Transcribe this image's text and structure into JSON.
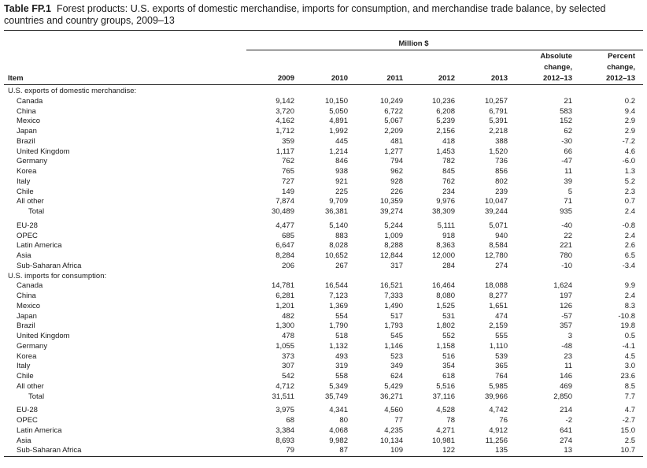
{
  "title": {
    "label": "Table FP.1",
    "text": "Forest products: U.S. exports of domestic merchandise, imports for consumption, and merchandise trade balance, by selected countries and country groups, 2009–13"
  },
  "header": {
    "unit": "Million $",
    "item": "Item",
    "years": [
      "2009",
      "2010",
      "2011",
      "2012",
      "2013"
    ],
    "abs_change": [
      "Absolute",
      "change,",
      "2012–13"
    ],
    "pct_change": [
      "Percent",
      "change,",
      "2012–13"
    ]
  },
  "rows": [
    {
      "type": "section",
      "label": "U.S. exports of domestic merchandise:"
    },
    {
      "label": "Canada",
      "values": [
        "9,142",
        "10,150",
        "10,249",
        "10,236",
        "10,257",
        "21",
        "0.2"
      ]
    },
    {
      "label": "China",
      "values": [
        "3,720",
        "5,050",
        "6,722",
        "6,208",
        "6,791",
        "583",
        "9.4"
      ]
    },
    {
      "label": "Mexico",
      "values": [
        "4,162",
        "4,891",
        "5,067",
        "5,239",
        "5,391",
        "152",
        "2.9"
      ]
    },
    {
      "label": "Japan",
      "values": [
        "1,712",
        "1,992",
        "2,209",
        "2,156",
        "2,218",
        "62",
        "2.9"
      ]
    },
    {
      "label": "Brazil",
      "values": [
        "359",
        "445",
        "481",
        "418",
        "388",
        "-30",
        "-7.2"
      ]
    },
    {
      "label": "United Kingdom",
      "values": [
        "1,117",
        "1,214",
        "1,277",
        "1,453",
        "1,520",
        "66",
        "4.6"
      ]
    },
    {
      "label": "Germany",
      "values": [
        "762",
        "846",
        "794",
        "782",
        "736",
        "-47",
        "-6.0"
      ]
    },
    {
      "label": "Korea",
      "values": [
        "765",
        "938",
        "962",
        "845",
        "856",
        "11",
        "1.3"
      ]
    },
    {
      "label": "Italy",
      "values": [
        "727",
        "921",
        "928",
        "762",
        "802",
        "39",
        "5.2"
      ]
    },
    {
      "label": "Chile",
      "values": [
        "149",
        "225",
        "226",
        "234",
        "239",
        "5",
        "2.3"
      ]
    },
    {
      "label": "All other",
      "values": [
        "7,874",
        "9,709",
        "10,359",
        "9,976",
        "10,047",
        "71",
        "0.7"
      ]
    },
    {
      "label": "Total",
      "indent": true,
      "values": [
        "30,489",
        "36,381",
        "39,274",
        "38,309",
        "39,244",
        "935",
        "2.4"
      ]
    },
    {
      "type": "gap"
    },
    {
      "label": "EU-28",
      "values": [
        "4,477",
        "5,140",
        "5,244",
        "5,111",
        "5,071",
        "-40",
        "-0.8"
      ]
    },
    {
      "label": "OPEC",
      "values": [
        "685",
        "883",
        "1,009",
        "918",
        "940",
        "22",
        "2.4"
      ]
    },
    {
      "label": "Latin America",
      "values": [
        "6,647",
        "8,028",
        "8,288",
        "8,363",
        "8,584",
        "221",
        "2.6"
      ]
    },
    {
      "label": "Asia",
      "values": [
        "8,284",
        "10,652",
        "12,844",
        "12,000",
        "12,780",
        "780",
        "6.5"
      ]
    },
    {
      "label": "Sub-Saharan Africa",
      "values": [
        "206",
        "267",
        "317",
        "284",
        "274",
        "-10",
        "-3.4"
      ]
    },
    {
      "type": "section",
      "label": "U.S. imports for consumption:"
    },
    {
      "label": "Canada",
      "values": [
        "14,781",
        "16,544",
        "16,521",
        "16,464",
        "18,088",
        "1,624",
        "9.9"
      ]
    },
    {
      "label": "China",
      "values": [
        "6,281",
        "7,123",
        "7,333",
        "8,080",
        "8,277",
        "197",
        "2.4"
      ]
    },
    {
      "label": "Mexico",
      "values": [
        "1,201",
        "1,369",
        "1,490",
        "1,525",
        "1,651",
        "126",
        "8.3"
      ]
    },
    {
      "label": "Japan",
      "values": [
        "482",
        "554",
        "517",
        "531",
        "474",
        "-57",
        "-10.8"
      ]
    },
    {
      "label": "Brazil",
      "values": [
        "1,300",
        "1,790",
        "1,793",
        "1,802",
        "2,159",
        "357",
        "19.8"
      ]
    },
    {
      "label": "United Kingdom",
      "values": [
        "478",
        "518",
        "545",
        "552",
        "555",
        "3",
        "0.5"
      ]
    },
    {
      "label": "Germany",
      "values": [
        "1,055",
        "1,132",
        "1,146",
        "1,158",
        "1,110",
        "-48",
        "-4.1"
      ]
    },
    {
      "label": "Korea",
      "values": [
        "373",
        "493",
        "523",
        "516",
        "539",
        "23",
        "4.5"
      ]
    },
    {
      "label": "Italy",
      "values": [
        "307",
        "319",
        "349",
        "354",
        "365",
        "11",
        "3.0"
      ]
    },
    {
      "label": "Chile",
      "values": [
        "542",
        "558",
        "624",
        "618",
        "764",
        "146",
        "23.6"
      ]
    },
    {
      "label": "All other",
      "values": [
        "4,712",
        "5,349",
        "5,429",
        "5,516",
        "5,985",
        "469",
        "8.5"
      ]
    },
    {
      "label": "Total",
      "indent": true,
      "values": [
        "31,511",
        "35,749",
        "36,271",
        "37,116",
        "39,966",
        "2,850",
        "7.7"
      ]
    },
    {
      "type": "gap"
    },
    {
      "label": "EU-28",
      "values": [
        "3,975",
        "4,341",
        "4,560",
        "4,528",
        "4,742",
        "214",
        "4.7"
      ]
    },
    {
      "label": "OPEC",
      "values": [
        "68",
        "80",
        "77",
        "78",
        "76",
        "-2",
        "-2.7"
      ]
    },
    {
      "label": "Latin America",
      "values": [
        "3,384",
        "4,068",
        "4,235",
        "4,271",
        "4,912",
        "641",
        "15.0"
      ]
    },
    {
      "label": "Asia",
      "values": [
        "8,693",
        "9,982",
        "10,134",
        "10,981",
        "11,256",
        "274",
        "2.5"
      ]
    },
    {
      "label": "Sub-Saharan Africa",
      "values": [
        "79",
        "87",
        "109",
        "122",
        "135",
        "13",
        "10.7"
      ]
    }
  ]
}
